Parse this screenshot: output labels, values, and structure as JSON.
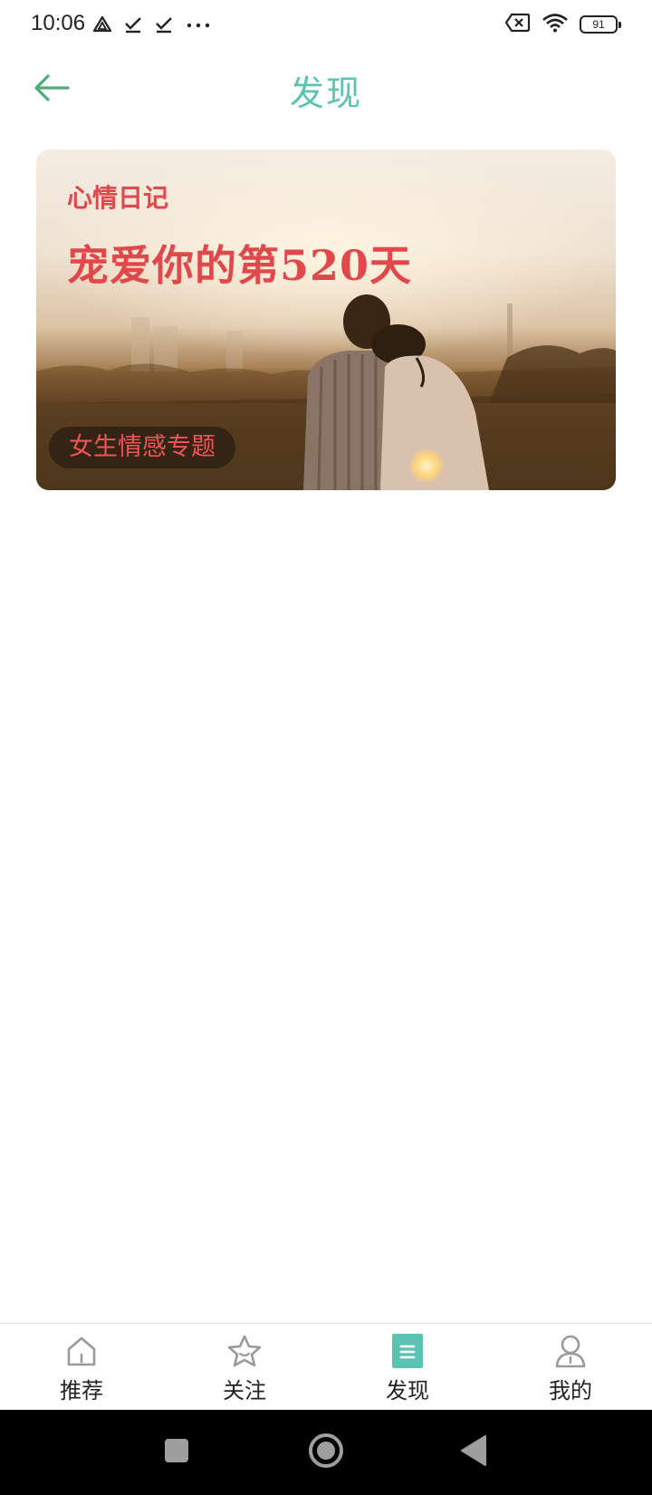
{
  "status_bar": {
    "time": "10:06",
    "battery": "91",
    "icons": [
      "drive-icon",
      "download-done-icon",
      "download-done-icon",
      "more-dots-icon",
      "sim-off-icon",
      "wifi-icon",
      "battery-icon"
    ]
  },
  "header": {
    "title": "发现",
    "back_icon": "arrow-left-icon"
  },
  "banner": {
    "kicker": "心情日记",
    "headline": "宠爱你的第520天",
    "tag": "女生情感专题"
  },
  "bottom_nav": {
    "items": [
      {
        "label": "推荐",
        "icon": "home-icon",
        "active": false
      },
      {
        "label": "关注",
        "icon": "star-icon",
        "active": false
      },
      {
        "label": "发现",
        "icon": "discover-icon",
        "active": true
      },
      {
        "label": "我的",
        "icon": "profile-icon",
        "active": false
      }
    ]
  },
  "colors": {
    "accent": "#5cc3b2",
    "back_arrow": "#4cae74",
    "banner_text": "#e0484b",
    "nav_icon_inactive": "#9a9a9a"
  }
}
